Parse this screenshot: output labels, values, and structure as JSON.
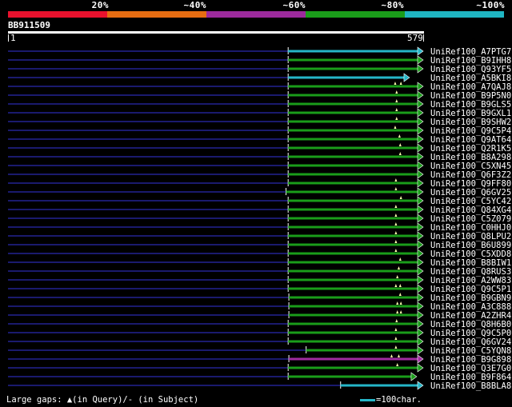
{
  "legend": [
    {
      "label": "20%",
      "color": "#e8112d"
    },
    {
      "label": "~40%",
      "color": "#e66d12"
    },
    {
      "label": "~60%",
      "color": "#9c2a9c"
    },
    {
      "label": "~80%",
      "color": "#1a9d1a"
    },
    {
      "label": "~100%",
      "color": "#1fb5c2"
    }
  ],
  "query": {
    "id": "BB911509",
    "start": "1",
    "end": "579"
  },
  "footer": {
    "gaps_note": "Large gaps: ▲(in Query)/- (in Subject)",
    "scale_note": "=100char."
  },
  "chart_data": {
    "type": "alignment",
    "query_length": 579,
    "hits": [
      {
        "name": "UniRef100_A7PTG7",
        "start": 391,
        "end": 579,
        "color": "cyan",
        "gaps": []
      },
      {
        "name": "UniRef100_B9IHH8",
        "start": 391,
        "end": 579,
        "color": "green",
        "gaps": []
      },
      {
        "name": "UniRef100_Q93YF5",
        "start": 391,
        "end": 579,
        "color": "green",
        "gaps": []
      },
      {
        "name": "UniRef100_A5BKI8",
        "start": 391,
        "end": 560,
        "color": "cyan",
        "gaps": []
      },
      {
        "name": "UniRef100_A7QAJ8",
        "start": 391,
        "end": 579,
        "color": "green",
        "gaps": [
          540,
          548
        ]
      },
      {
        "name": "UniRef100_B9P5N0",
        "start": 391,
        "end": 579,
        "color": "green",
        "gaps": [
          542
        ]
      },
      {
        "name": "UniRef100_B9GLS5",
        "start": 391,
        "end": 579,
        "color": "green",
        "gaps": [
          542
        ]
      },
      {
        "name": "UniRef100_B9GXL1",
        "start": 391,
        "end": 579,
        "color": "green",
        "gaps": [
          542
        ]
      },
      {
        "name": "UniRef100_B9SHW2",
        "start": 391,
        "end": 579,
        "color": "green",
        "gaps": [
          542
        ]
      },
      {
        "name": "UniRef100_Q9C5P4",
        "start": 391,
        "end": 579,
        "color": "green",
        "gaps": [
          540
        ]
      },
      {
        "name": "UniRef100_Q9AT64",
        "start": 391,
        "end": 579,
        "color": "green",
        "gaps": [
          546
        ]
      },
      {
        "name": "UniRef100_Q2R1K5",
        "start": 391,
        "end": 579,
        "color": "green",
        "gaps": [
          547
        ]
      },
      {
        "name": "UniRef100_B8A298",
        "start": 391,
        "end": 579,
        "color": "green",
        "gaps": [
          547
        ]
      },
      {
        "name": "UniRef100_C5XN45",
        "start": 391,
        "end": 579,
        "color": "green",
        "gaps": []
      },
      {
        "name": "UniRef100_Q6F3Z2",
        "start": 391,
        "end": 579,
        "color": "green",
        "gaps": []
      },
      {
        "name": "UniRef100_Q9FF80",
        "start": 391,
        "end": 579,
        "color": "green",
        "gaps": [
          541
        ]
      },
      {
        "name": "UniRef100_Q6GV25",
        "start": 388,
        "end": 579,
        "color": "green",
        "gaps": [
          541
        ]
      },
      {
        "name": "UniRef100_C5YC42",
        "start": 391,
        "end": 579,
        "color": "green",
        "gaps": [
          548
        ]
      },
      {
        "name": "UniRef100_Q84XG4",
        "start": 391,
        "end": 579,
        "color": "green",
        "gaps": [
          541
        ]
      },
      {
        "name": "UniRef100_C5Z079",
        "start": 391,
        "end": 579,
        "color": "green",
        "gaps": [
          541
        ]
      },
      {
        "name": "UniRef100_C0HHJ0",
        "start": 391,
        "end": 579,
        "color": "green",
        "gaps": [
          541
        ]
      },
      {
        "name": "UniRef100_Q8LPU2",
        "start": 391,
        "end": 579,
        "color": "green",
        "gaps": [
          541
        ]
      },
      {
        "name": "UniRef100_B6U899",
        "start": 391,
        "end": 579,
        "color": "green",
        "gaps": [
          541
        ]
      },
      {
        "name": "UniRef100_C5XDD8",
        "start": 391,
        "end": 579,
        "color": "green",
        "gaps": [
          541
        ]
      },
      {
        "name": "UniRef100_B8BIW1",
        "start": 391,
        "end": 579,
        "color": "green",
        "gaps": [
          547
        ]
      },
      {
        "name": "UniRef100_Q8RUS3",
        "start": 391,
        "end": 579,
        "color": "green",
        "gaps": [
          545
        ]
      },
      {
        "name": "UniRef100_A2WW83",
        "start": 391,
        "end": 579,
        "color": "green",
        "gaps": [
          543
        ]
      },
      {
        "name": "UniRef100_Q9C5P1",
        "start": 391,
        "end": 579,
        "color": "green",
        "gaps": [
          541,
          547
        ]
      },
      {
        "name": "UniRef100_B9GBN9",
        "start": 392,
        "end": 579,
        "color": "green",
        "gaps": [
          547
        ]
      },
      {
        "name": "UniRef100_A3C888",
        "start": 392,
        "end": 579,
        "color": "green",
        "gaps": [
          543,
          548
        ]
      },
      {
        "name": "UniRef100_A2ZHR4",
        "start": 392,
        "end": 579,
        "color": "green",
        "gaps": [
          543,
          548
        ]
      },
      {
        "name": "UniRef100_Q8H6B0",
        "start": 391,
        "end": 579,
        "color": "green",
        "gaps": [
          542
        ]
      },
      {
        "name": "UniRef100_Q9C5P0",
        "start": 391,
        "end": 579,
        "color": "green",
        "gaps": [
          541
        ]
      },
      {
        "name": "UniRef100_Q6GV24",
        "start": 391,
        "end": 579,
        "color": "green",
        "gaps": [
          541
        ]
      },
      {
        "name": "UniRef100_C5YQN8",
        "start": 416,
        "end": 579,
        "color": "green",
        "gaps": [
          541
        ]
      },
      {
        "name": "UniRef100_B9G898",
        "start": 392,
        "end": 579,
        "color": "purple",
        "gaps": [
          535,
          545
        ]
      },
      {
        "name": "UniRef100_Q3E7G0",
        "start": 391,
        "end": 579,
        "color": "green",
        "gaps": [
          543
        ]
      },
      {
        "name": "UniRef100_B9F864",
        "start": 391,
        "end": 570,
        "color": "green",
        "gaps": []
      },
      {
        "name": "UniRef100_B8BLA8",
        "start": 464,
        "end": 579,
        "color": "cyan",
        "gaps": []
      }
    ]
  }
}
